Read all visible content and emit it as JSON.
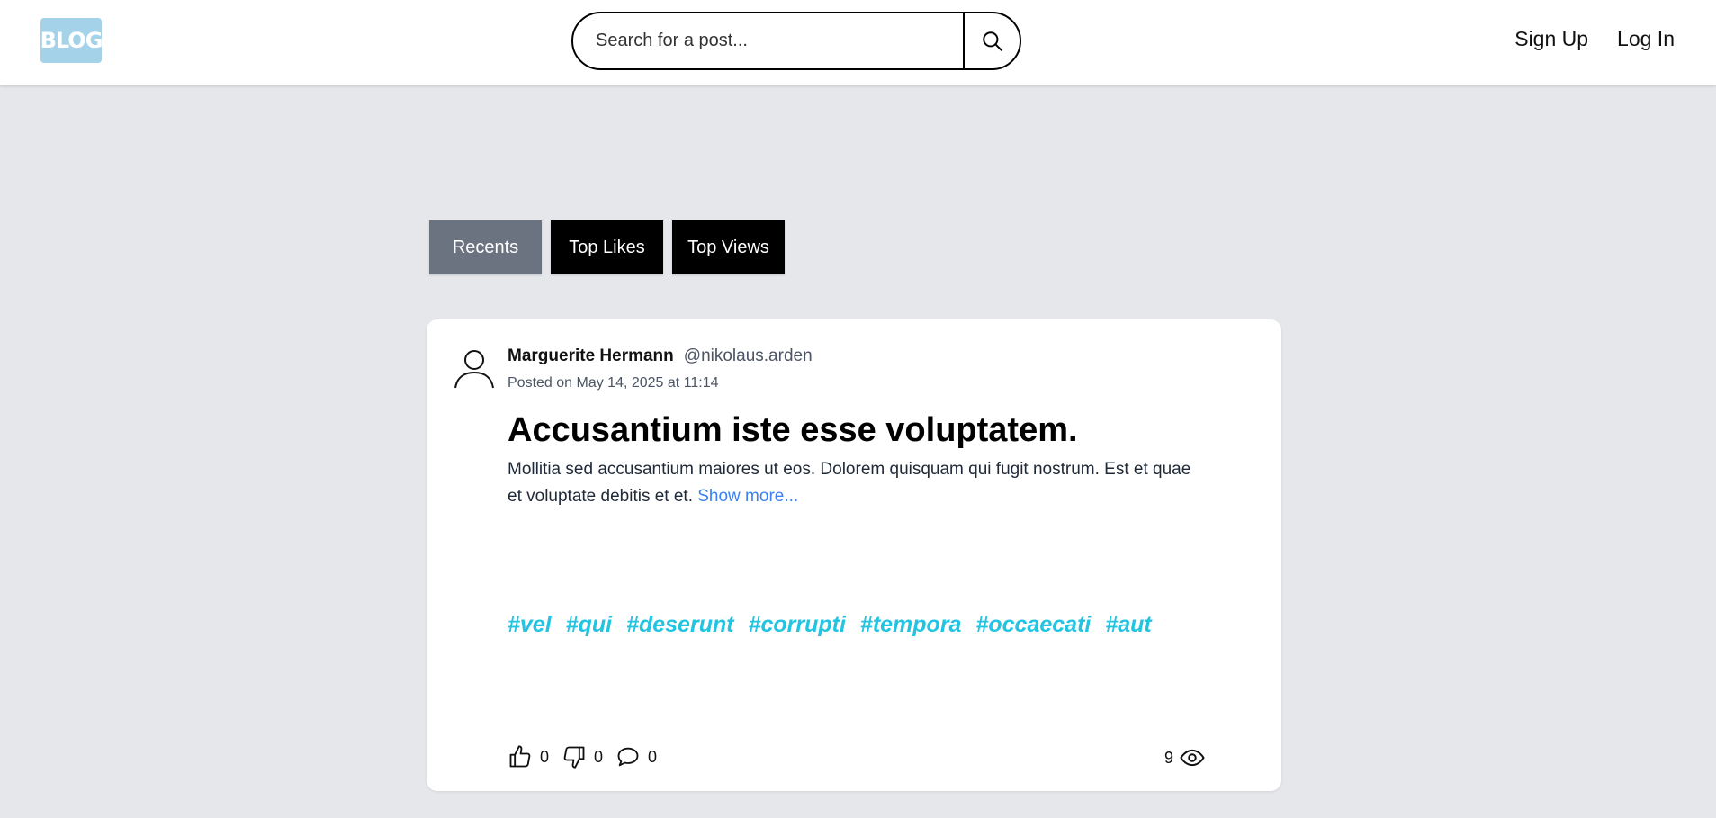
{
  "header": {
    "logo_text": "BLOG",
    "search_placeholder": "Search for a post...",
    "search_icon": "search-icon",
    "signup_label": "Sign Up",
    "login_label": "Log In"
  },
  "tabs": [
    {
      "label": "Recents",
      "active": true
    },
    {
      "label": "Top Likes",
      "active": false
    },
    {
      "label": "Top Views",
      "active": false
    }
  ],
  "post": {
    "author_name": "Marguerite Hermann",
    "author_handle": "@nikolaus.arden",
    "posted": "Posted on May 14, 2025 at 11:14",
    "title": "Accusantium iste esse voluptatem.",
    "excerpt": "Mollitia sed accusantium maiores ut eos. Dolorem quisquam qui fugit nostrum. Est et quae et voluptate debitis et et.",
    "show_more": "Show more...",
    "tags": [
      "#vel",
      "#qui",
      "#deserunt",
      "#corrupti",
      "#tempora",
      "#occaecati",
      "#aut"
    ],
    "likes": "0",
    "dislikes": "0",
    "comments": "0",
    "views": "9"
  },
  "colors": {
    "background": "#e5e7eb",
    "logo_bg": "#a3d2e9",
    "active_tab": "#6b7280",
    "tag": "#22c4e2",
    "link": "#3b82f6"
  }
}
